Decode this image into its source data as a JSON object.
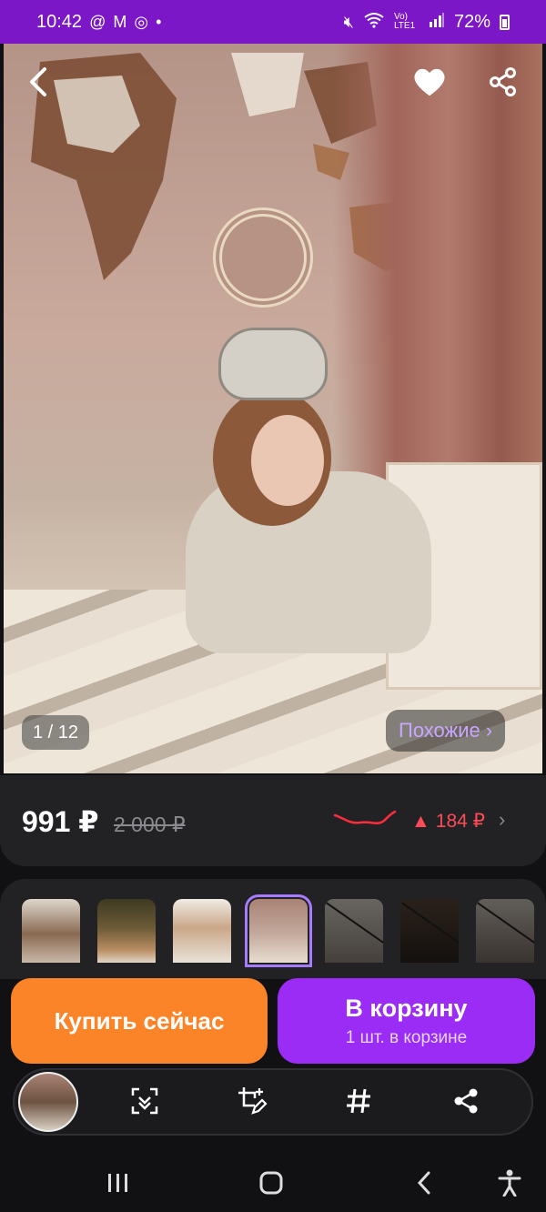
{
  "status_bar": {
    "time": "10:42",
    "notification_icons": [
      "at-sign-icon",
      "gmail-icon",
      "instagram-icon",
      "dot-icon"
    ],
    "network_label": "Vo) LTE1",
    "battery": "72%"
  },
  "gallery": {
    "counter": "1 / 12",
    "similar_label": "Похожие",
    "similar_chevron": "›",
    "current_index": 1,
    "total": 12
  },
  "price": {
    "current": "991 ₽",
    "old": "2 000 ₽",
    "change_arrow": "▲",
    "change": "184 ₽",
    "chevron": "›",
    "change_color": "#ff4a57"
  },
  "thumbnails": [
    {
      "selected": false,
      "dimmed": false
    },
    {
      "selected": false,
      "dimmed": false
    },
    {
      "selected": false,
      "dimmed": false
    },
    {
      "selected": true,
      "dimmed": false
    },
    {
      "selected": false,
      "dimmed": true
    },
    {
      "selected": false,
      "dimmed": true
    },
    {
      "selected": false,
      "dimmed": true
    }
  ],
  "actions": {
    "buy_now": "Купить сейчас",
    "add_to_cart": "В корзину",
    "in_cart": "1 шт. в корзине",
    "buy_color": "#fb8429",
    "cart_color": "#9b2cf5"
  },
  "toolbar": {
    "tools": [
      "scan-icon",
      "edit-crop-icon",
      "hashtag-icon",
      "share-icon"
    ]
  },
  "accent": "#7b17c7"
}
